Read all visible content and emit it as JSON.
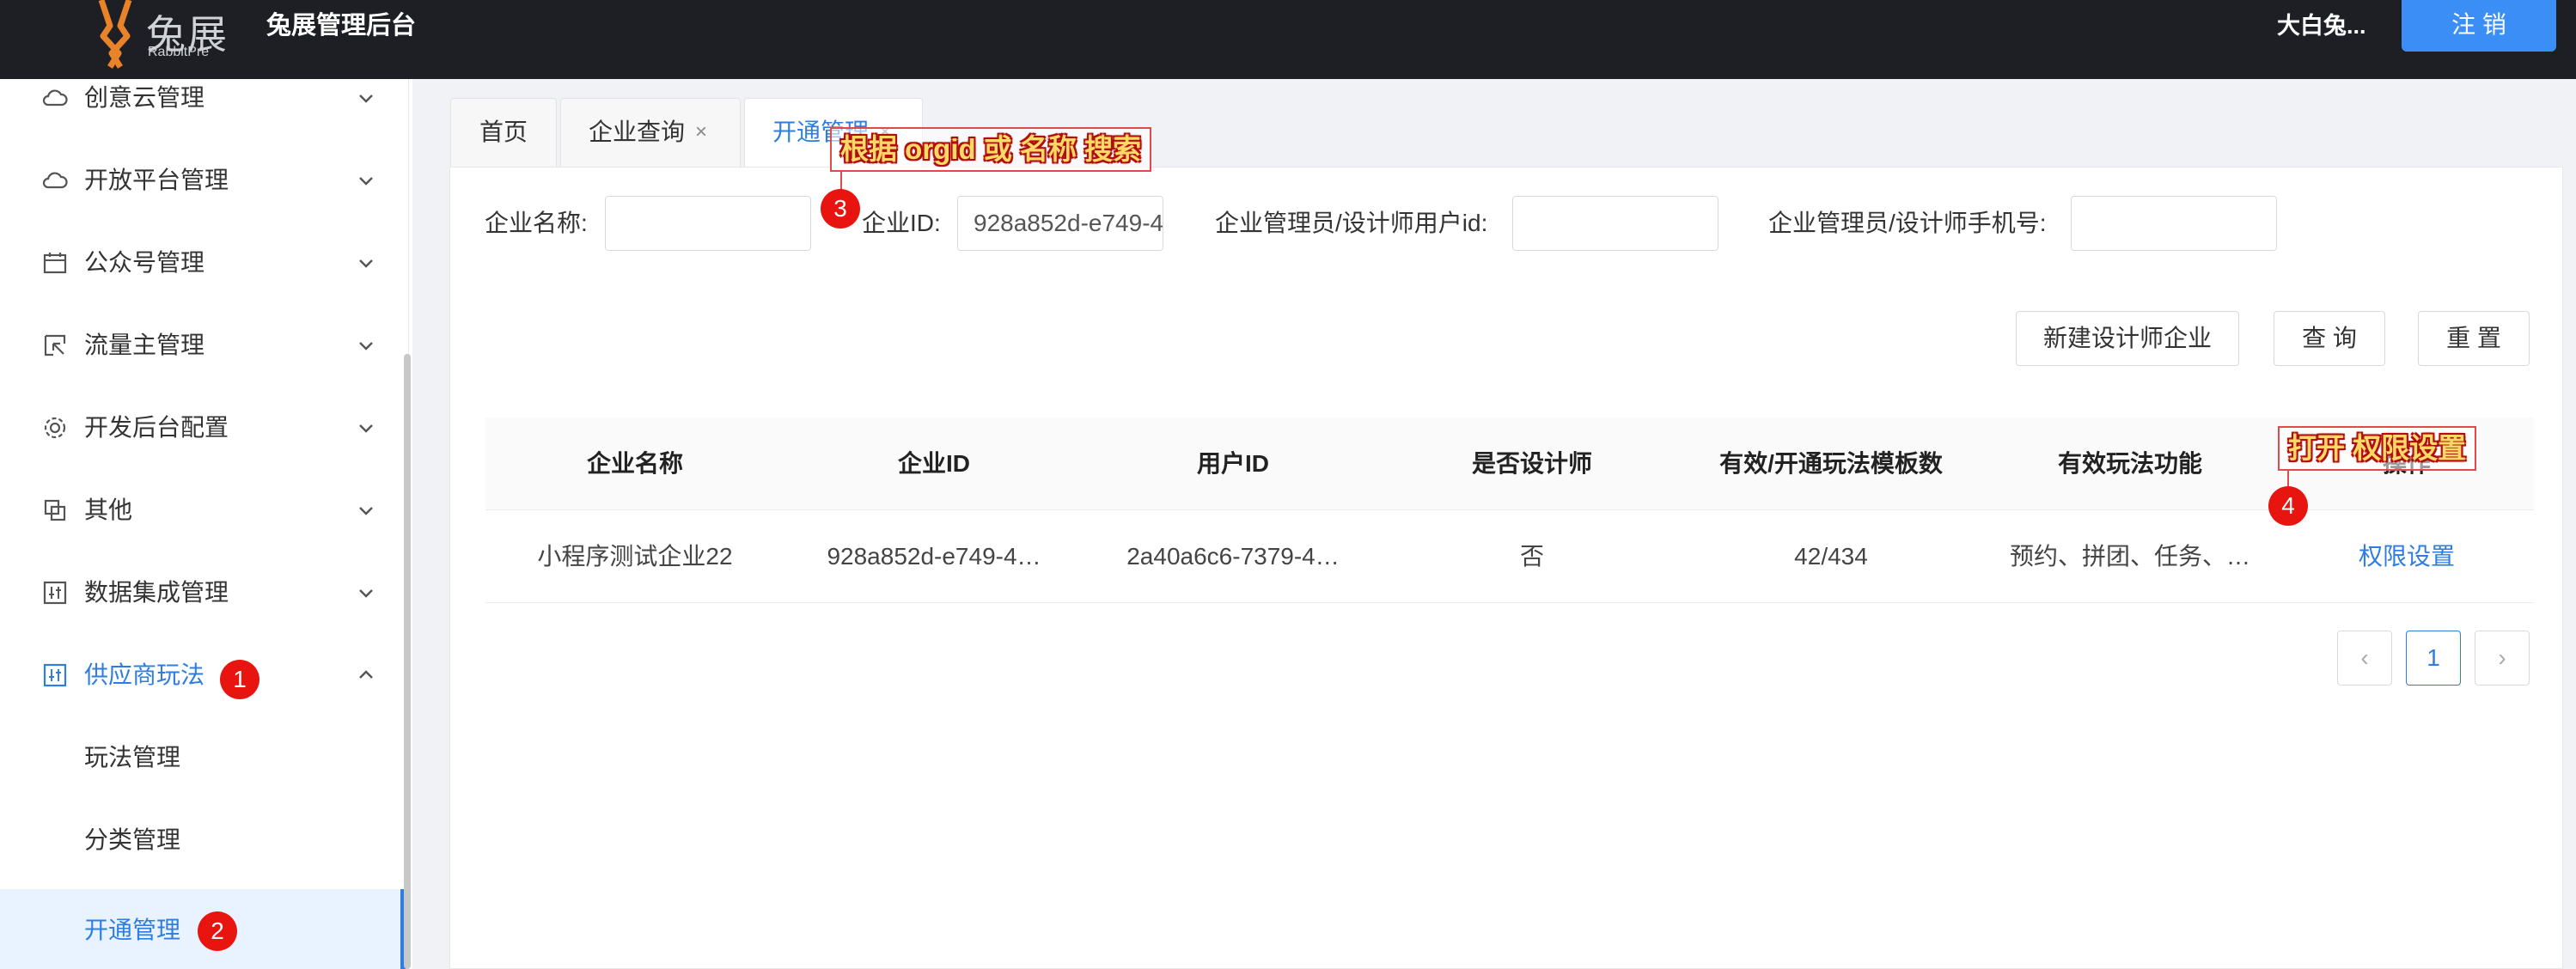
{
  "header": {
    "logo_text": "兔展",
    "logo_sub": "RabbitPre",
    "app_title": "兔展管理后台",
    "user_name": "大白兔...",
    "logout_label": "注 销"
  },
  "sidebar": {
    "items": [
      {
        "label": "创意云管理",
        "icon": "cloud-icon"
      },
      {
        "label": "开放平台管理",
        "icon": "cloud-icon"
      },
      {
        "label": "公众号管理",
        "icon": "calendar-icon"
      },
      {
        "label": "流量主管理",
        "icon": "cursor-icon"
      },
      {
        "label": "开发后台配置",
        "icon": "gear-icon"
      },
      {
        "label": "其他",
        "icon": "copy-icon"
      },
      {
        "label": "数据集成管理",
        "icon": "sliders-icon"
      },
      {
        "label": "供应商玩法",
        "icon": "sliders-icon"
      }
    ],
    "sub_items": [
      {
        "label": "玩法管理"
      },
      {
        "label": "分类管理"
      },
      {
        "label": "开通管理"
      }
    ]
  },
  "tabs": [
    {
      "label": "首页"
    },
    {
      "label": "企业查询"
    },
    {
      "label": "开通管理"
    }
  ],
  "filters": {
    "company_name_label": "企业名称:",
    "company_name_value": "",
    "company_id_label": "企业ID:",
    "company_id_value": "928a852d-e749-4",
    "admin_userid_label": "企业管理员/设计师用户id:",
    "admin_userid_value": "",
    "admin_phone_label": "企业管理员/设计师手机号:",
    "admin_phone_value": ""
  },
  "actions": {
    "new_label": "新建设计师企业",
    "query_label": "查 询",
    "reset_label": "重 置"
  },
  "table": {
    "headers": [
      "企业名称",
      "企业ID",
      "用户ID",
      "是否设计师",
      "有效/开通玩法模板数",
      "有效玩法功能",
      "操作"
    ],
    "row": {
      "name": "小程序测试企业22",
      "company_id": "928a852d-e749-4…",
      "user_id": "2a40a6c6-7379-4…",
      "is_designer": "否",
      "templates": "42/434",
      "features": "预约、拼团、任务、…",
      "action": "权限设置"
    }
  },
  "pagination": {
    "prev": "‹",
    "current": "1",
    "next": "›"
  },
  "annotations": {
    "badge1": "1",
    "badge2": "2",
    "badge3": "3",
    "badge4": "4",
    "callout3": "根据 orgid 或 名称 搜索",
    "callout4": "打开 权限设置"
  },
  "colors": {
    "accent": "#2f7de1",
    "header_bg": "#1d1f24",
    "logout_bg": "#3b8ef5",
    "annotation_red": "#e8140f",
    "logo_orange": "#e8832a"
  }
}
